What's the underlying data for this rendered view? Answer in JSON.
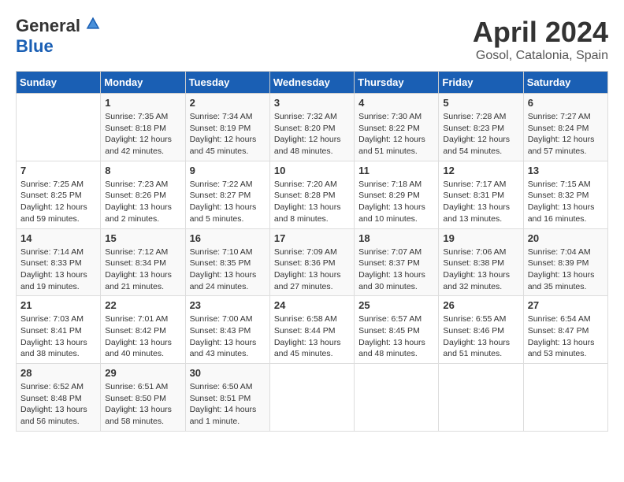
{
  "header": {
    "logo_general": "General",
    "logo_blue": "Blue",
    "month": "April 2024",
    "location": "Gosol, Catalonia, Spain"
  },
  "columns": [
    "Sunday",
    "Monday",
    "Tuesday",
    "Wednesday",
    "Thursday",
    "Friday",
    "Saturday"
  ],
  "weeks": [
    [
      {
        "day": "",
        "info": ""
      },
      {
        "day": "1",
        "info": "Sunrise: 7:35 AM\nSunset: 8:18 PM\nDaylight: 12 hours\nand 42 minutes."
      },
      {
        "day": "2",
        "info": "Sunrise: 7:34 AM\nSunset: 8:19 PM\nDaylight: 12 hours\nand 45 minutes."
      },
      {
        "day": "3",
        "info": "Sunrise: 7:32 AM\nSunset: 8:20 PM\nDaylight: 12 hours\nand 48 minutes."
      },
      {
        "day": "4",
        "info": "Sunrise: 7:30 AM\nSunset: 8:22 PM\nDaylight: 12 hours\nand 51 minutes."
      },
      {
        "day": "5",
        "info": "Sunrise: 7:28 AM\nSunset: 8:23 PM\nDaylight: 12 hours\nand 54 minutes."
      },
      {
        "day": "6",
        "info": "Sunrise: 7:27 AM\nSunset: 8:24 PM\nDaylight: 12 hours\nand 57 minutes."
      }
    ],
    [
      {
        "day": "7",
        "info": "Sunrise: 7:25 AM\nSunset: 8:25 PM\nDaylight: 12 hours\nand 59 minutes."
      },
      {
        "day": "8",
        "info": "Sunrise: 7:23 AM\nSunset: 8:26 PM\nDaylight: 13 hours\nand 2 minutes."
      },
      {
        "day": "9",
        "info": "Sunrise: 7:22 AM\nSunset: 8:27 PM\nDaylight: 13 hours\nand 5 minutes."
      },
      {
        "day": "10",
        "info": "Sunrise: 7:20 AM\nSunset: 8:28 PM\nDaylight: 13 hours\nand 8 minutes."
      },
      {
        "day": "11",
        "info": "Sunrise: 7:18 AM\nSunset: 8:29 PM\nDaylight: 13 hours\nand 10 minutes."
      },
      {
        "day": "12",
        "info": "Sunrise: 7:17 AM\nSunset: 8:31 PM\nDaylight: 13 hours\nand 13 minutes."
      },
      {
        "day": "13",
        "info": "Sunrise: 7:15 AM\nSunset: 8:32 PM\nDaylight: 13 hours\nand 16 minutes."
      }
    ],
    [
      {
        "day": "14",
        "info": "Sunrise: 7:14 AM\nSunset: 8:33 PM\nDaylight: 13 hours\nand 19 minutes."
      },
      {
        "day": "15",
        "info": "Sunrise: 7:12 AM\nSunset: 8:34 PM\nDaylight: 13 hours\nand 21 minutes."
      },
      {
        "day": "16",
        "info": "Sunrise: 7:10 AM\nSunset: 8:35 PM\nDaylight: 13 hours\nand 24 minutes."
      },
      {
        "day": "17",
        "info": "Sunrise: 7:09 AM\nSunset: 8:36 PM\nDaylight: 13 hours\nand 27 minutes."
      },
      {
        "day": "18",
        "info": "Sunrise: 7:07 AM\nSunset: 8:37 PM\nDaylight: 13 hours\nand 30 minutes."
      },
      {
        "day": "19",
        "info": "Sunrise: 7:06 AM\nSunset: 8:38 PM\nDaylight: 13 hours\nand 32 minutes."
      },
      {
        "day": "20",
        "info": "Sunrise: 7:04 AM\nSunset: 8:39 PM\nDaylight: 13 hours\nand 35 minutes."
      }
    ],
    [
      {
        "day": "21",
        "info": "Sunrise: 7:03 AM\nSunset: 8:41 PM\nDaylight: 13 hours\nand 38 minutes."
      },
      {
        "day": "22",
        "info": "Sunrise: 7:01 AM\nSunset: 8:42 PM\nDaylight: 13 hours\nand 40 minutes."
      },
      {
        "day": "23",
        "info": "Sunrise: 7:00 AM\nSunset: 8:43 PM\nDaylight: 13 hours\nand 43 minutes."
      },
      {
        "day": "24",
        "info": "Sunrise: 6:58 AM\nSunset: 8:44 PM\nDaylight: 13 hours\nand 45 minutes."
      },
      {
        "day": "25",
        "info": "Sunrise: 6:57 AM\nSunset: 8:45 PM\nDaylight: 13 hours\nand 48 minutes."
      },
      {
        "day": "26",
        "info": "Sunrise: 6:55 AM\nSunset: 8:46 PM\nDaylight: 13 hours\nand 51 minutes."
      },
      {
        "day": "27",
        "info": "Sunrise: 6:54 AM\nSunset: 8:47 PM\nDaylight: 13 hours\nand 53 minutes."
      }
    ],
    [
      {
        "day": "28",
        "info": "Sunrise: 6:52 AM\nSunset: 8:48 PM\nDaylight: 13 hours\nand 56 minutes."
      },
      {
        "day": "29",
        "info": "Sunrise: 6:51 AM\nSunset: 8:50 PM\nDaylight: 13 hours\nand 58 minutes."
      },
      {
        "day": "30",
        "info": "Sunrise: 6:50 AM\nSunset: 8:51 PM\nDaylight: 14 hours\nand 1 minute."
      },
      {
        "day": "",
        "info": ""
      },
      {
        "day": "",
        "info": ""
      },
      {
        "day": "",
        "info": ""
      },
      {
        "day": "",
        "info": ""
      }
    ]
  ]
}
